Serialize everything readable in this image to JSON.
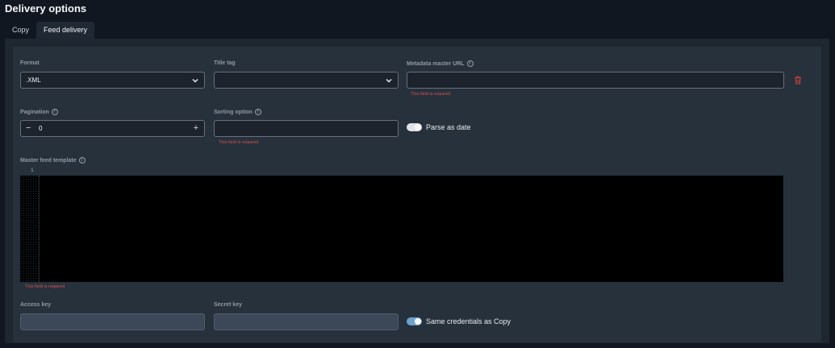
{
  "page": {
    "title": "Delivery options"
  },
  "tabs": [
    {
      "label": "Copy",
      "active": false
    },
    {
      "label": "Feed delivery",
      "active": true
    }
  ],
  "form": {
    "format": {
      "label": "Format",
      "value": ".XML"
    },
    "title_tag": {
      "label": "Title tag",
      "value": ""
    },
    "metadata_master_url": {
      "label": "Metadata master URL",
      "value": "",
      "error": "This field is required"
    },
    "pagination": {
      "label": "Pagination",
      "value": "0",
      "minus": "−",
      "plus": "+"
    },
    "sorting_option": {
      "label": "Sorting option",
      "value": "",
      "error": "This field is required"
    },
    "parse_as_date": {
      "label": "Parse as date",
      "enabled": false
    },
    "master_feed_template": {
      "label": "Master feed template",
      "line_number": "1",
      "error": "This field is required"
    },
    "access_key": {
      "label": "Access key",
      "value": ""
    },
    "secret_key": {
      "label": "Secret key",
      "value": ""
    },
    "same_credentials": {
      "label": "Same credentials as Copy",
      "enabled": true
    }
  },
  "icons": {
    "info": "info-icon",
    "chevron": "chevron-down-icon",
    "delete": "trash-icon"
  },
  "colors": {
    "error": "#d0504d",
    "toggle_on": "#6fa2cd",
    "background": "#111720",
    "panel": "#27313c"
  }
}
